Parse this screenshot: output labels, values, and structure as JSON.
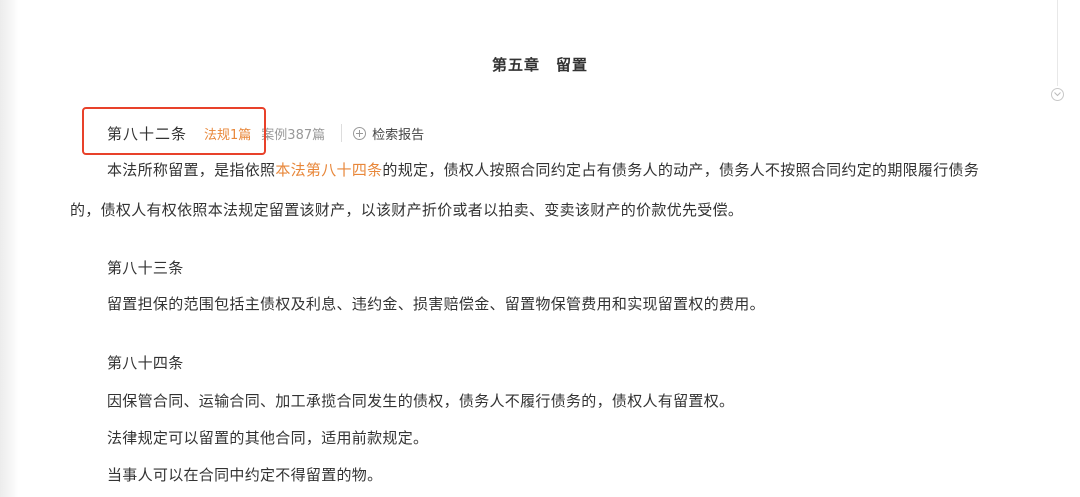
{
  "chapter_title": "第五章　留置",
  "articles": [
    {
      "number": "第八十二条",
      "law_tag": "法规1篇",
      "case_tag": "案例387篇",
      "report_label": "检索报告",
      "text_before": "本法所称留置，是指依照",
      "link_text": "本法第八十四条",
      "text_after": "的规定，债权人按照合同约定占有债务人的动产，债务人不按照合同约定的期限履行债务的，债权人有权依照本法规定留置该财产，以该财产折价或者以拍卖、变卖该财产的价款优先受偿。"
    },
    {
      "number": "第八十三条",
      "text": "留置担保的范围包括主债权及利息、违约金、损害赔偿金、留置物保管费用和实现留置权的费用。"
    },
    {
      "number": "第八十四条",
      "paragraphs": [
        "因保管合同、运输合同、加工承揽合同发生的债权，债务人不履行债务的，债权人有留置权。",
        "法律规定可以留置的其他合同，适用前款规定。",
        "当事人可以在合同中约定不得留置的物。"
      ]
    }
  ],
  "colors": {
    "link": "#e8873a",
    "highlight": "#e8412a",
    "text": "#333333",
    "muted": "#999999"
  },
  "icons": {
    "report": "plus-circle-icon",
    "scroll": "chevron-down-icon"
  }
}
